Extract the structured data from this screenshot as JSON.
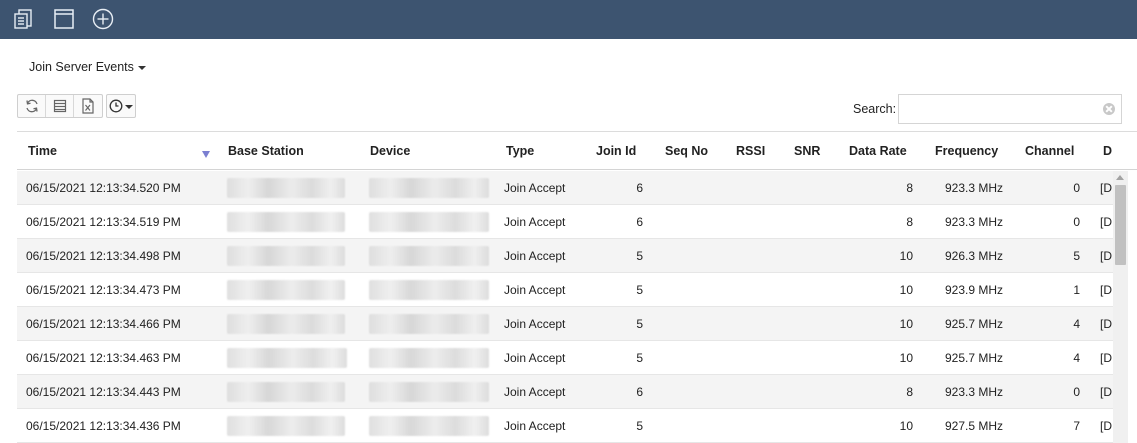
{
  "topbar": {
    "color": "#3d5470",
    "icons": [
      "list-doc-icon",
      "window-icon",
      "add-circle-icon"
    ]
  },
  "view": {
    "title": "Join Server Events"
  },
  "toolbar": {
    "icons": [
      "refresh-icon",
      "columns-icon",
      "excel-export-icon",
      "clock-icon"
    ]
  },
  "search": {
    "label": "Search:",
    "value": "",
    "placeholder": ""
  },
  "table": {
    "columns": [
      "Time",
      "Base Station",
      "Device",
      "Type",
      "Join Id",
      "Seq No",
      "RSSI",
      "SNR",
      "Data Rate",
      "Frequency",
      "Channel",
      "D"
    ],
    "sort_color": "#7b7fd1",
    "rows": [
      {
        "time": "06/15/2021 12:13:34.520 PM",
        "type": "Join Accept",
        "join_id": "6",
        "data_rate": "8",
        "frequency": "923.3 MHz",
        "channel": "0",
        "d": "[D"
      },
      {
        "time": "06/15/2021 12:13:34.519 PM",
        "type": "Join Accept",
        "join_id": "6",
        "data_rate": "8",
        "frequency": "923.3 MHz",
        "channel": "0",
        "d": "[D"
      },
      {
        "time": "06/15/2021 12:13:34.498 PM",
        "type": "Join Accept",
        "join_id": "5",
        "data_rate": "10",
        "frequency": "926.3 MHz",
        "channel": "5",
        "d": "[D"
      },
      {
        "time": "06/15/2021 12:13:34.473 PM",
        "type": "Join Accept",
        "join_id": "5",
        "data_rate": "10",
        "frequency": "923.9 MHz",
        "channel": "1",
        "d": "[D"
      },
      {
        "time": "06/15/2021 12:13:34.466 PM",
        "type": "Join Accept",
        "join_id": "5",
        "data_rate": "10",
        "frequency": "925.7 MHz",
        "channel": "4",
        "d": "[D"
      },
      {
        "time": "06/15/2021 12:13:34.463 PM",
        "type": "Join Accept",
        "join_id": "5",
        "data_rate": "10",
        "frequency": "925.7 MHz",
        "channel": "4",
        "d": "[D"
      },
      {
        "time": "06/15/2021 12:13:34.443 PM",
        "type": "Join Accept",
        "join_id": "6",
        "data_rate": "8",
        "frequency": "923.3 MHz",
        "channel": "0",
        "d": "[D"
      },
      {
        "time": "06/15/2021 12:13:34.436 PM",
        "type": "Join Accept",
        "join_id": "5",
        "data_rate": "10",
        "frequency": "927.5 MHz",
        "channel": "7",
        "d": "[D"
      }
    ]
  }
}
